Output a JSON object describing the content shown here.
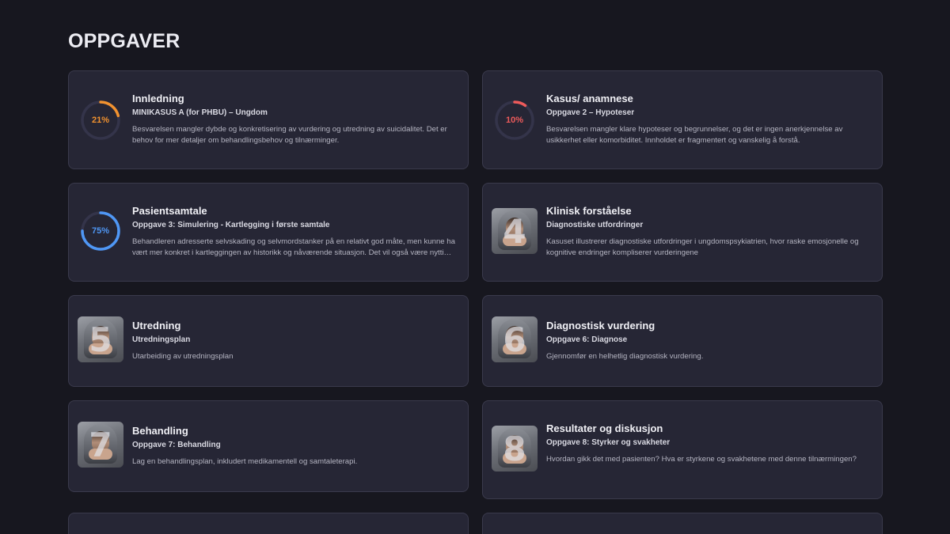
{
  "page_title": "OPPGAVER",
  "colors": {
    "orange": "#f2922f",
    "red": "#ee5b5b",
    "blue": "#4f97f5",
    "track": "#34344a"
  },
  "cards": [
    {
      "title": "Innledning",
      "subtitle": "MINIKASUS A (for PHBU) – Ungdom",
      "description": "Besvarelsen mangler dybde og konkretisering av vurdering og utredning av suicidalitet. Det er behov for mer detaljer om behandlingsbehov og tilnærminger.",
      "progress_label": "21%",
      "progress": 0.21,
      "progress_color": "#f2922f"
    },
    {
      "title": "Kasus/ anamnese",
      "subtitle": "Oppgave 2 – Hypoteser",
      "description": "Besvarelsen mangler klare hypoteser og begrunnelser, og det er ingen anerkjennelse av usikkerhet eller komorbiditet. Innholdet er fragmentert og vanskelig å forstå.",
      "progress_label": "10%",
      "progress": 0.1,
      "progress_color": "#ee5b5b"
    },
    {
      "title": "Pasientsamtale",
      "subtitle": "Oppgave 3: Simulering - Kartlegging i første samtale",
      "description": "Behandleren adresserte selvskading og selvmordstanker på en relativt god måte, men kunne ha vært mer konkret i kartleggingen av historikk og nåværende situasjon. Det vil også være nyttig å utforske mer.",
      "progress_label": "75%",
      "progress": 0.75,
      "progress_color": "#4f97f5"
    },
    {
      "title": "Klinisk forståelse",
      "subtitle": "Diagnostiske utfordringer",
      "description": "Kasuset illustrerer diagnostiske utfordringer i ungdomspsykiatrien, hvor raske emosjonelle og kognitive endringer kompliserer vurderingene",
      "number": "4"
    },
    {
      "title": "Utredning",
      "subtitle": "Utredningsplan",
      "description": "Utarbeiding av utredningsplan",
      "number": "5"
    },
    {
      "title": "Diagnostisk vurdering",
      "subtitle": "Oppgave 6: Diagnose",
      "description": "Gjennomfør en helhetlig diagnostisk vurdering.",
      "number": "6"
    },
    {
      "title": "Behandling",
      "subtitle": "Oppgave 7: Behandling",
      "description": "Lag en behandlingsplan, inkludert medikamentell og samtaleterapi.",
      "number": "7"
    },
    {
      "title": "Resultater og diskusjon",
      "subtitle": "Oppgave 8: Styrker og svakheter",
      "description": "Hvordan gikk det med pasienten? Hva er styrkene og svakhetene med denne tilnærmingen?",
      "number": "8"
    }
  ]
}
